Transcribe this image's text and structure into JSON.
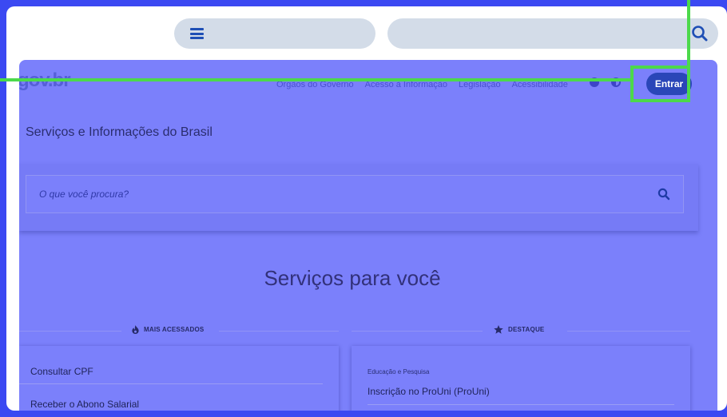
{
  "header": {
    "menu_icon": "hamburger-icon",
    "search_icon": "search-icon"
  },
  "site": {
    "logo": "gov.br",
    "nav_links": [
      "Órgãos do Governo",
      "Acesso à Informação",
      "Legislação",
      "Acessibilidade"
    ],
    "nav_icons": [
      "help-icon",
      "contrast-icon"
    ],
    "login_button": "Entrar",
    "title": "Serviços e Informações do Brasil",
    "search_placeholder": "O que você procura?"
  },
  "services": {
    "heading": "Serviços para você",
    "most_accessed": {
      "label": "MAIS ACESSADOS",
      "icon": "fire-icon",
      "items": [
        "Consultar CPF",
        "Receber o Abono Salarial"
      ]
    },
    "featured": {
      "label": "DESTAQUE",
      "icon": "star-icon",
      "category": "Educação e Pesquisa",
      "item": "Inscrição no ProUni (ProUni)"
    }
  },
  "colors": {
    "outer_frame": "#3b49f2",
    "overlay": "#7b80fb",
    "highlight": "#4cd94b",
    "button": "#2a46b8"
  }
}
